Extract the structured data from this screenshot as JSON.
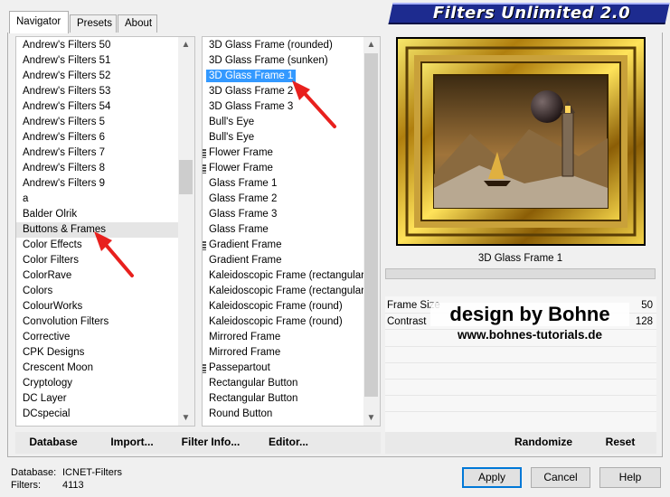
{
  "tabs": [
    {
      "label": "Navigator",
      "active": true
    },
    {
      "label": "Presets",
      "active": false
    },
    {
      "label": "About",
      "active": false
    }
  ],
  "banner": {
    "title": "Filters Unlimited 2.0"
  },
  "categories": {
    "items": [
      "Andrew's Filters 50",
      "Andrew's Filters 51",
      "Andrew's Filters 52",
      "Andrew's Filters 53",
      "Andrew's Filters 54",
      "Andrew's Filters 5",
      "Andrew's Filters 6",
      "Andrew's Filters 7",
      "Andrew's Filters 8",
      "Andrew's Filters 9",
      "a",
      "Balder Olrik",
      "Buttons & Frames",
      "Color Effects",
      "Color Filters",
      "ColorRave",
      "Colors",
      "ColourWorks",
      "Convolution Filters",
      "Corrective",
      "CPK Designs",
      "Crescent Moon",
      "Cryptology",
      "DC Layer",
      "DCspecial"
    ],
    "highlighted_index": 12
  },
  "filters": {
    "items": [
      {
        "label": "3D Glass Frame (rounded)",
        "grip": false
      },
      {
        "label": "3D Glass Frame (sunken)",
        "grip": false
      },
      {
        "label": "3D Glass Frame 1",
        "grip": false
      },
      {
        "label": "3D Glass Frame 2",
        "grip": false
      },
      {
        "label": "3D Glass Frame 3",
        "grip": false
      },
      {
        "label": "Bull's Eye",
        "grip": false
      },
      {
        "label": "Bull's Eye",
        "grip": false
      },
      {
        "label": "Flower Frame",
        "grip": true
      },
      {
        "label": "Flower Frame",
        "grip": true
      },
      {
        "label": "Glass Frame 1",
        "grip": false
      },
      {
        "label": "Glass Frame 2",
        "grip": false
      },
      {
        "label": "Glass Frame 3",
        "grip": false
      },
      {
        "label": "Glass Frame",
        "grip": false
      },
      {
        "label": "Gradient Frame",
        "grip": true
      },
      {
        "label": "Gradient Frame",
        "grip": false
      },
      {
        "label": "Kaleidoscopic Frame (rectangular)",
        "grip": false
      },
      {
        "label": "Kaleidoscopic Frame (rectangular)",
        "grip": false
      },
      {
        "label": "Kaleidoscopic Frame (round)",
        "grip": false
      },
      {
        "label": "Kaleidoscopic Frame (round)",
        "grip": false
      },
      {
        "label": "Mirrored Frame",
        "grip": false
      },
      {
        "label": "Mirrored Frame",
        "grip": false
      },
      {
        "label": "Passepartout",
        "grip": true
      },
      {
        "label": "Rectangular Button",
        "grip": false
      },
      {
        "label": "Rectangular Button",
        "grip": false
      },
      {
        "label": "Round Button",
        "grip": false
      }
    ],
    "selected_index": 2
  },
  "left_toolbar": {
    "database": "Database",
    "import": "Import...",
    "filter_info": "Filter Info...",
    "editor": "Editor..."
  },
  "preview": {
    "filter_name": "3D Glass Frame 1",
    "params": [
      {
        "name": "Frame Size",
        "value": "50"
      },
      {
        "name": "Contrast",
        "value": "128"
      }
    ],
    "watermark_title": "design by Bohne",
    "watermark_url": "www.bohnes-tutorials.de"
  },
  "right_toolbar": {
    "randomize": "Randomize",
    "reset": "Reset"
  },
  "status": {
    "database_label": "Database:",
    "database_value": "ICNET-Filters",
    "filters_label": "Filters:",
    "filters_value": "4113"
  },
  "buttons": {
    "apply": "Apply",
    "cancel": "Cancel",
    "help": "Help"
  },
  "colors": {
    "selection": "#3399ff",
    "banner": "#1d2b8f",
    "arrow": "#e8201d"
  }
}
